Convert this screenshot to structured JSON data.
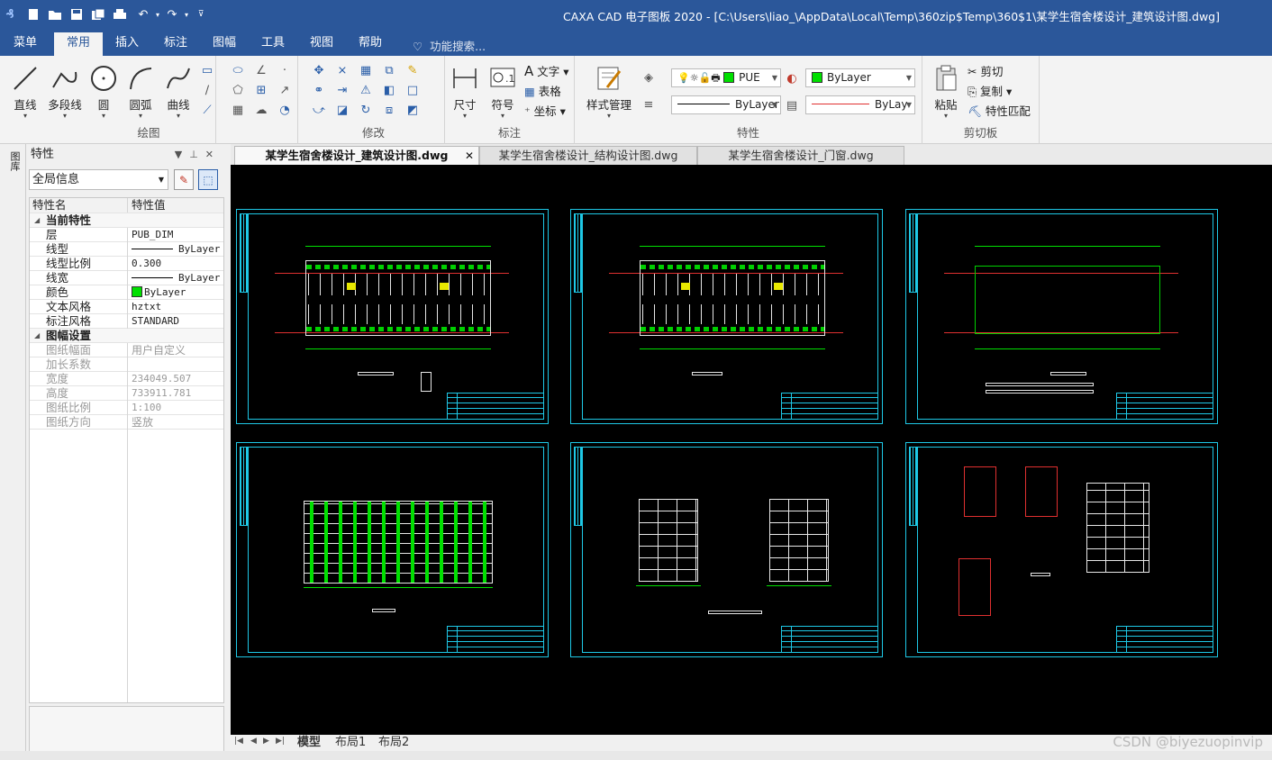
{
  "window": {
    "title": "CAXA CAD 电子图板 2020 - [C:\\Users\\liao_\\AppData\\Local\\Temp\\360zip$Temp\\360$1\\某学生宿舍楼设计_建筑设计图.dwg]"
  },
  "menu_tabs": [
    "菜单",
    "常用",
    "插入",
    "标注",
    "图幅",
    "工具",
    "视图",
    "帮助"
  ],
  "search_placeholder": "功能搜索...",
  "ribbon": {
    "draw": {
      "label": "绘图",
      "buttons": [
        "直线",
        "多段线",
        "圆",
        "圆弧",
        "曲线"
      ]
    },
    "modify": {
      "label": "修改"
    },
    "annotate": {
      "label": "标注",
      "buttons": [
        "尺寸",
        "符号"
      ],
      "items": [
        "文字",
        "表格",
        "坐标"
      ]
    },
    "properties": {
      "label": "特性",
      "style_manager": "样式管理",
      "layer": "PUE",
      "color": "ByLayer",
      "linetype": "ByLayer",
      "linewidth": "ByLay"
    },
    "clipboard": {
      "label": "剪切板",
      "paste": "粘贴",
      "items": [
        "剪切",
        "复制",
        "特性匹配"
      ]
    }
  },
  "left_toolbar": {
    "label": "图库"
  },
  "panel": {
    "title": "特性",
    "scope": "全局信息",
    "headers": [
      "特性名",
      "特性值"
    ],
    "categories": [
      {
        "name": "当前特性",
        "rows": [
          {
            "name": "层",
            "value": "PUB_DIM"
          },
          {
            "name": "线型",
            "value": "ByLayer"
          },
          {
            "name": "线型比例",
            "value": "0.300"
          },
          {
            "name": "线宽",
            "value": "ByLayer"
          },
          {
            "name": "颜色",
            "value": "ByLayer"
          },
          {
            "name": "文本风格",
            "value": "hztxt"
          },
          {
            "name": "标注风格",
            "value": "STANDARD"
          }
        ]
      },
      {
        "name": "图幅设置",
        "rows": [
          {
            "name": "图纸幅面",
            "value": "用户自定义"
          },
          {
            "name": "加长系数",
            "value": ""
          },
          {
            "name": "宽度",
            "value": "234049.507"
          },
          {
            "name": "高度",
            "value": "733911.781"
          },
          {
            "name": "图纸比例",
            "value": "1:100"
          },
          {
            "name": "图纸方向",
            "value": "竖放"
          }
        ]
      }
    ]
  },
  "doc_tabs": [
    {
      "label": "某学生宿舍楼设计_建筑设计图.dwg",
      "active": true
    },
    {
      "label": "某学生宿舍楼设计_结构设计图.dwg",
      "active": false
    },
    {
      "label": "某学生宿舍楼设计_门窗.dwg",
      "active": false
    }
  ],
  "layout_tabs": [
    "模型",
    "布局1",
    "布局2"
  ],
  "watermark": "CSDN @biyezuopinvip",
  "colors": {
    "brand": "#2b579a",
    "canvas": "#000000",
    "frame": "#1ec8e6",
    "accent_green": "#00e000"
  }
}
